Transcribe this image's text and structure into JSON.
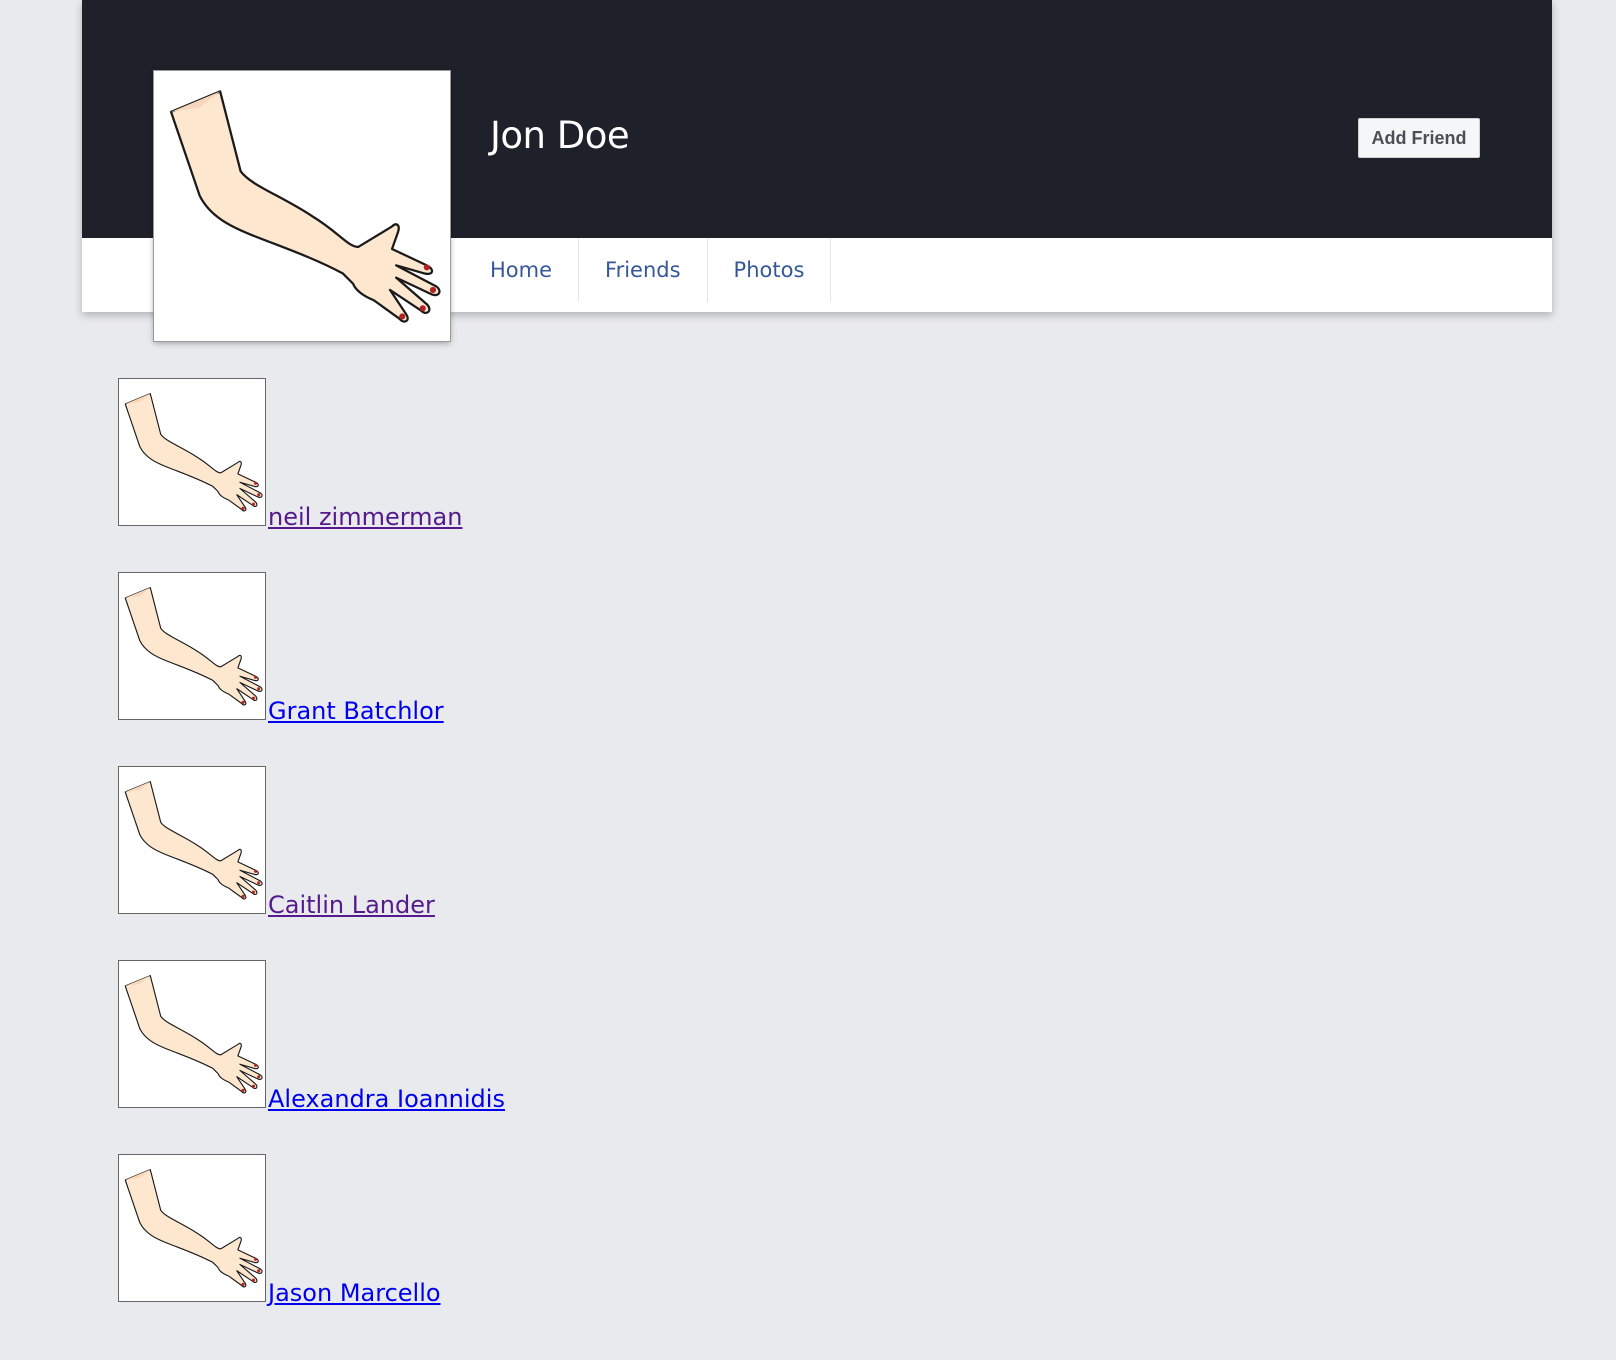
{
  "profile": {
    "name": "Jon Doe",
    "add_friend_label": "Add Friend"
  },
  "nav": {
    "items": [
      {
        "label": "Home"
      },
      {
        "label": "Friends"
      },
      {
        "label": "Photos"
      }
    ]
  },
  "friends": [
    {
      "name": "neil zimmerman",
      "visited": true
    },
    {
      "name": "Grant Batchlor",
      "visited": false
    },
    {
      "name": "Caitlin Lander",
      "visited": true
    },
    {
      "name": "Alexandra Ioannidis",
      "visited": false
    },
    {
      "name": "Jason Marcello",
      "visited": false
    }
  ],
  "colors": {
    "cover": "#1e212a",
    "background": "#e9eaee",
    "nav_link": "#365899",
    "link_visited": "#551a8b",
    "link_unvisited": "#0000ee",
    "skin": "#fde7cf"
  },
  "icons": {
    "avatar": "arm-hand-illustration"
  }
}
